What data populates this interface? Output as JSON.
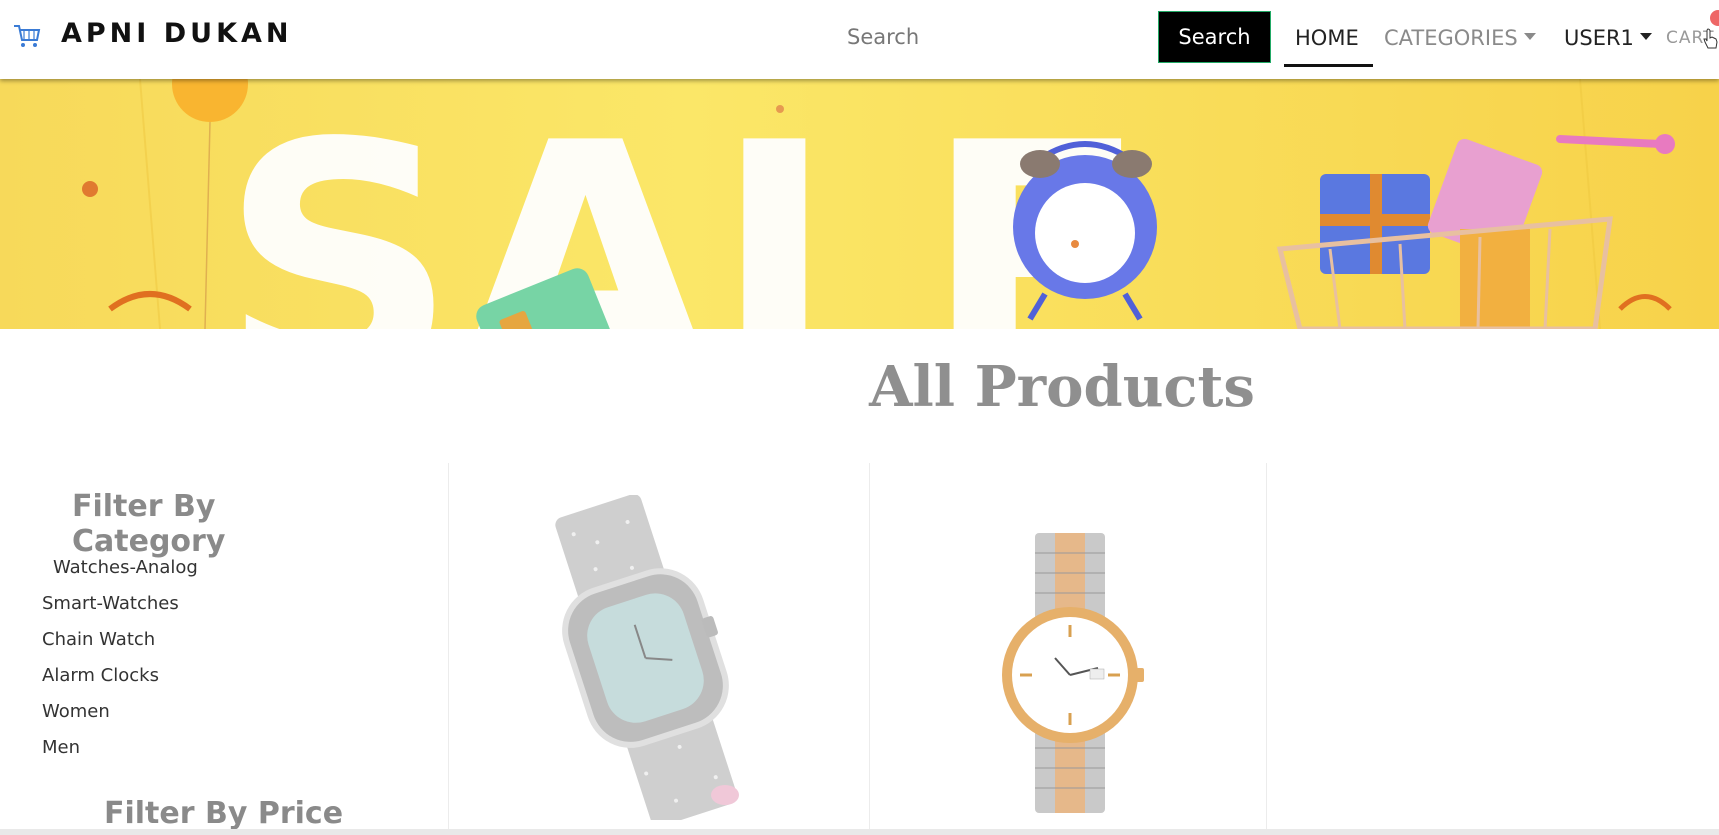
{
  "header": {
    "brand": "APNI DUKAN",
    "search_placeholder": "Search",
    "search_button": "Search",
    "nav": {
      "home": "HOME",
      "categories": "CATEGORIES",
      "user": "USER1",
      "cart": "CART"
    }
  },
  "banner": {
    "text": "SALE"
  },
  "main": {
    "heading": "All Products"
  },
  "sidebar": {
    "category_title": "Filter By Category",
    "categories": [
      "Watches-Analog",
      "Smart-Watches",
      "Chain Watch",
      "Alarm Clocks",
      "Women",
      "Men"
    ],
    "price_title": "Filter By Price"
  },
  "icons": {
    "brand": "cart-icon",
    "cursor": "hand-pointer-icon"
  },
  "colors": {
    "banner_yellow": "#f9dd55",
    "search_button_bg": "#000000",
    "heading_gray": "#8f8f8f",
    "cart_badge": "#ee6666"
  }
}
